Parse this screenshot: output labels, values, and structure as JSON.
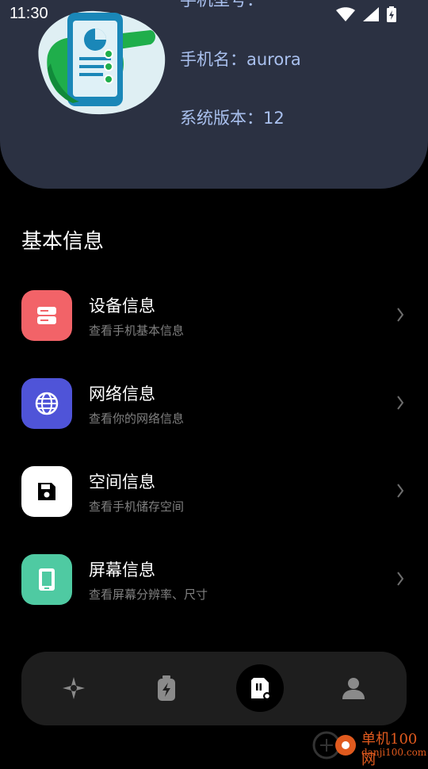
{
  "status": {
    "time": "11:30"
  },
  "header": {
    "model_line": "手机型号：",
    "name_line": "手机名：aurora",
    "version_line": "系统版本：12"
  },
  "section": {
    "title": "基本信息"
  },
  "menu": [
    {
      "title": "设备信息",
      "subtitle": "查看手机基本信息",
      "icon": "server-icon",
      "color": "#f26368"
    },
    {
      "title": "网络信息",
      "subtitle": "查看你的网络信息",
      "icon": "globe-icon",
      "color": "#4f54d8"
    },
    {
      "title": "空间信息",
      "subtitle": "查看手机储存空间",
      "icon": "save-icon",
      "color": "#ffffff"
    },
    {
      "title": "屏幕信息",
      "subtitle": "查看屏幕分辨率、尺寸",
      "icon": "phone-icon",
      "color": "#4fcaa2"
    }
  ],
  "nav": [
    {
      "icon": "tools-icon",
      "active": false
    },
    {
      "icon": "battery-icon",
      "active": false
    },
    {
      "icon": "sim-card-icon",
      "active": true
    },
    {
      "icon": "person-icon",
      "active": false
    }
  ],
  "watermark": {
    "line1": "单机100网",
    "line2": "danji100.com"
  }
}
